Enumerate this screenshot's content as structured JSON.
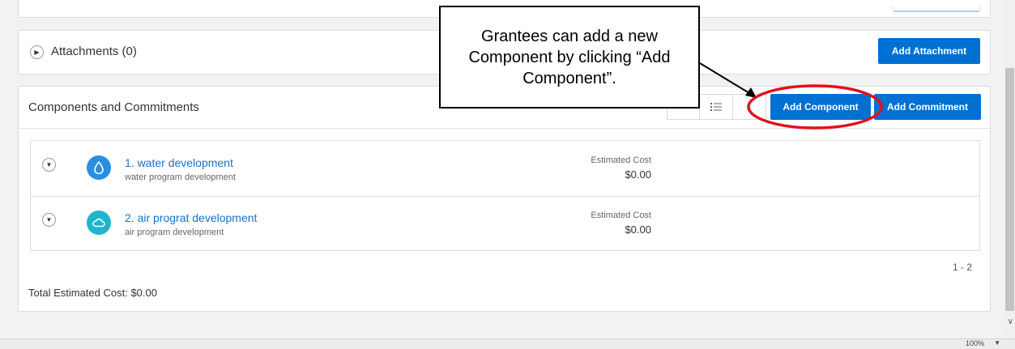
{
  "attachments": {
    "title": "Attachments (0)",
    "add_button": "Add Attachment"
  },
  "components": {
    "title": "Components and Commitments",
    "add_component_button": "Add Component",
    "add_commitment_button": "Add Commitment",
    "view_icons": [
      "list-icon"
    ],
    "items": [
      {
        "name": "1. water development",
        "description": "water program development",
        "cost_label": "Estimated Cost",
        "cost_value": "$0.00",
        "icon": "water-drop-icon",
        "icon_color": "#2a8fe0"
      },
      {
        "name": "2. air prograt development",
        "description": "air program development",
        "cost_label": "Estimated Cost",
        "cost_value": "$0.00",
        "icon": "cloud-icon",
        "icon_color": "#1fb5cc"
      }
    ],
    "pager": "1 - 2",
    "total_label": "Total Estimated Cost:",
    "total_value": "$0.00"
  },
  "callout": {
    "text": "Grantees can add a new Component by clicking “Add Component”."
  },
  "status_bar": {
    "zoom": "100%"
  },
  "colors": {
    "accent": "#0070d2",
    "link": "#1a6fc9",
    "highlight_ellipse": "#e0131b"
  }
}
